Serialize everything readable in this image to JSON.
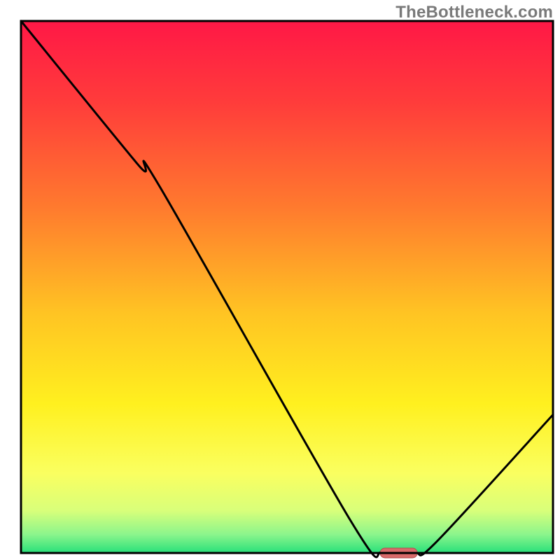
{
  "watermark": "TheBottleneck.com",
  "chart_data": {
    "type": "line",
    "title": "",
    "xlabel": "",
    "ylabel": "",
    "xlim": [
      0,
      100
    ],
    "ylim": [
      0,
      100
    ],
    "x": [
      0,
      22,
      26,
      62,
      68,
      74,
      78,
      100
    ],
    "values": [
      100,
      73,
      69,
      6,
      0,
      0,
      2,
      26
    ],
    "optimum_marker": {
      "x_center": 71,
      "x_half_width": 3.5,
      "y": 0
    },
    "gradient_stops": [
      {
        "offset": 0.0,
        "color": "#ff1846"
      },
      {
        "offset": 0.15,
        "color": "#ff3b3b"
      },
      {
        "offset": 0.35,
        "color": "#ff7a2e"
      },
      {
        "offset": 0.55,
        "color": "#ffc423"
      },
      {
        "offset": 0.72,
        "color": "#fff01f"
      },
      {
        "offset": 0.85,
        "color": "#faff60"
      },
      {
        "offset": 0.92,
        "color": "#d9ff7a"
      },
      {
        "offset": 0.965,
        "color": "#8cf58c"
      },
      {
        "offset": 1.0,
        "color": "#28e07a"
      }
    ],
    "colors": {
      "curve": "#000000",
      "frame": "#000000",
      "marker_fill": "#d86a6a",
      "marker_stroke": "#b24f4f"
    }
  }
}
